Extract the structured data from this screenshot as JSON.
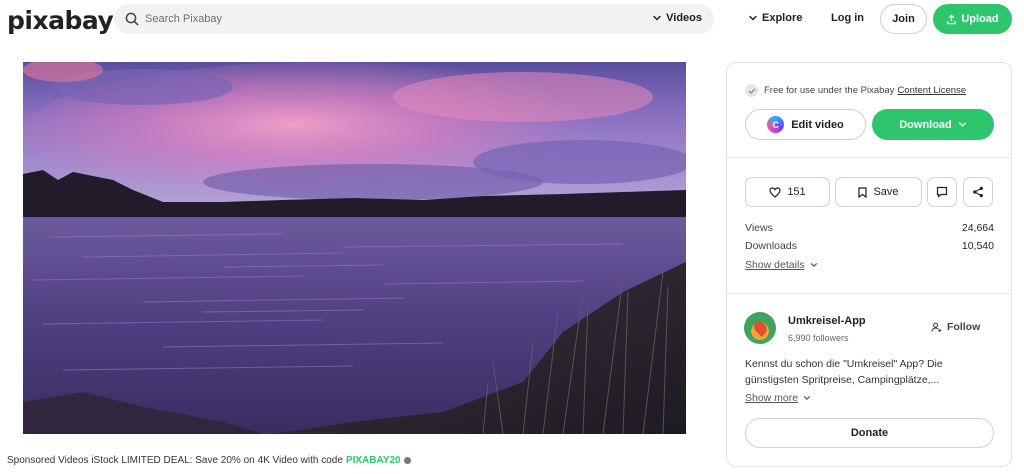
{
  "header": {
    "logo": "pixabay",
    "search_placeholder": "Search Pixabay",
    "filter_label": "Videos",
    "explore_label": "Explore",
    "login_label": "Log in",
    "join_label": "Join",
    "upload_label": "Upload"
  },
  "video": {
    "alt": "Lake at sunset with purple and pink clouds"
  },
  "sponsored": {
    "text": "Sponsored Videos iStock LIMITED DEAL: Save 20% on 4K Video with code",
    "code": "PIXABAY20"
  },
  "panel": {
    "license_text": "Free for use under the Pixabay",
    "license_link": "Content License",
    "edit_label": "Edit video",
    "download_label": "Download",
    "likes": "151",
    "save_label": "Save",
    "stats": [
      {
        "label": "Views",
        "value": "24,664"
      },
      {
        "label": "Downloads",
        "value": "10,540"
      }
    ],
    "show_details": "Show details",
    "user": {
      "name": "Umkreisel-App",
      "followers": "6,990 followers",
      "follow_label": "Follow"
    },
    "bio": [
      "Kennst du schon die \"Umkreisel\" App? Die",
      "günstigsten Spritpreise, Campingplätze,..."
    ],
    "show_more": "Show more",
    "donate_label": "Donate"
  },
  "colors": {
    "brand_green": "#2ec66d",
    "border": "#d0d0d0"
  }
}
